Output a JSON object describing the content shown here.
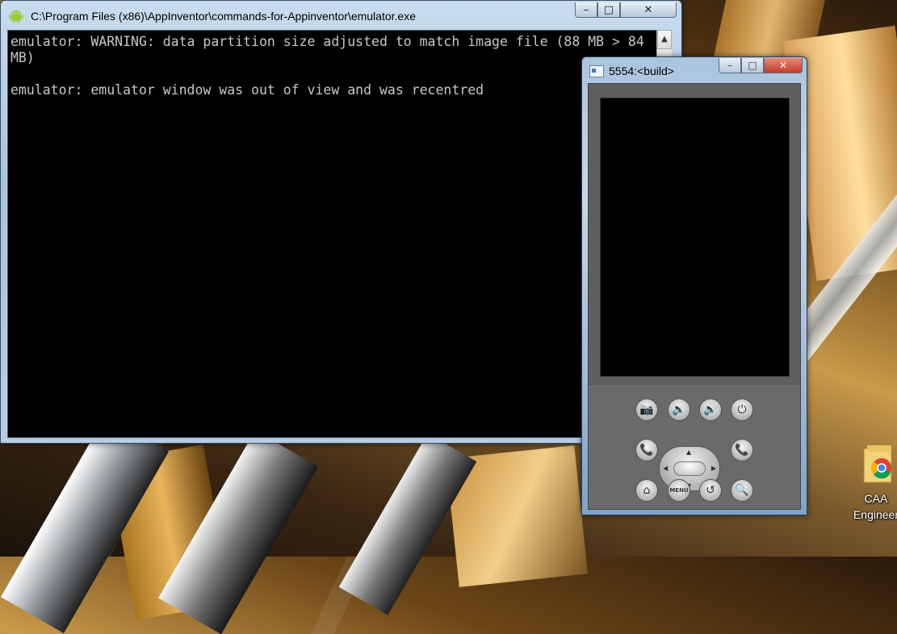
{
  "console": {
    "title": "C:\\Program Files (x86)\\AppInventor\\commands-for-Appinventor\\emulator.exe",
    "lines": "emulator: WARNING: data partition size adjusted to match image file (88 MB > 84\nMB)\n\nemulator: emulator window was out of view and was recentred",
    "controls": {
      "minimize": "–",
      "maximize": "□",
      "close": "✕"
    }
  },
  "emulator": {
    "title": "5554:<build>",
    "controls": {
      "minimize": "–",
      "maximize": "□",
      "close": "✕"
    },
    "keys": {
      "camera": "📷",
      "volume_down": "🔉",
      "volume_up": "🔊",
      "power": "⏻",
      "call": "📞",
      "end_call": "📞",
      "home": "⌂",
      "menu": "MENU",
      "back": "↺",
      "search": "🔍"
    },
    "key_colors": {
      "call": "#2e8b3a",
      "end_call": "#c0262a"
    }
  },
  "desktop": {
    "icon_label_line1": "CAA",
    "icon_label_line2": "Engineer"
  }
}
